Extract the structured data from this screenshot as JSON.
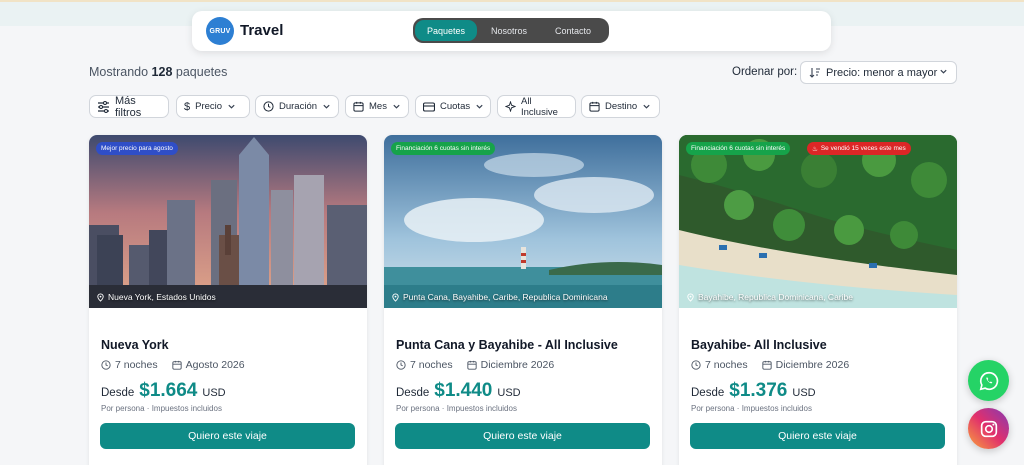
{
  "brand": {
    "logo_text": "GRUV",
    "name": "Travel"
  },
  "nav": [
    "Paquetes",
    "Nosotros",
    "Contacto"
  ],
  "results": {
    "prefix": "Mostrando",
    "count": "128",
    "suffix": "paquetes"
  },
  "sort": {
    "label": "Ordenar por:",
    "value": "Precio: menor a mayor"
  },
  "filters": {
    "more": "Más filtros",
    "price": "Precio",
    "duration": "Duración",
    "month": "Mes",
    "installments": "Cuotas",
    "all_inclusive": "All Inclusive",
    "destination": "Destino"
  },
  "cards": [
    {
      "badges": [
        {
          "text": "Mejor precio para agosto",
          "color": "#2f4ec7"
        }
      ],
      "location": "Nueva York, Estados Unidos",
      "title": "Nueva York",
      "nights": "7 noches",
      "date": "Agosto 2026",
      "desde": "Desde",
      "price": "$1.664",
      "currency": "USD",
      "note": "Por persona · Impuestos incluidos",
      "cta": "Quiero este viaje"
    },
    {
      "badges": [
        {
          "text": "Financiación 6 cuotas sin interés",
          "color": "#16a34a"
        }
      ],
      "location": "Punta Cana, Bayahibe, Caribe, Republica Dominicana",
      "title": "Punta Cana y Bayahibe - All Inclusive",
      "nights": "7 noches",
      "date": "Diciembre 2026",
      "desde": "Desde",
      "price": "$1.440",
      "currency": "USD",
      "note": "Por persona · Impuestos incluidos",
      "cta": "Quiero este viaje"
    },
    {
      "badges": [
        {
          "text": "Financiación 6 cuotas sin interés",
          "color": "#16a34a"
        },
        {
          "text": "Se vendió 15 veces este mes",
          "color": "#dc2626"
        }
      ],
      "location": "Bayahibe, Republica Dominicana, Caribe",
      "title": "Bayahibe- All Inclusive",
      "nights": "7 noches",
      "date": "Diciembre 2026",
      "desde": "Desde",
      "price": "$1.376",
      "currency": "USD",
      "note": "Por persona · Impuestos incluidos",
      "cta": "Quiero este viaje"
    }
  ],
  "colors": {
    "accent": "#0f8b87",
    "nav_bg": "#4a4a4a"
  },
  "floating": {
    "whatsapp": "whatsapp-icon",
    "instagram": "instagram-icon"
  }
}
